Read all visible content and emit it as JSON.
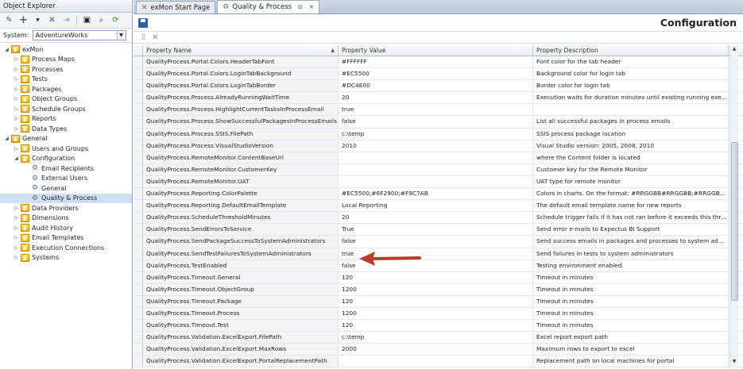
{
  "explorer": {
    "title": "Object Explorer",
    "system_label": "System:",
    "system_value": "AdventureWorks",
    "tree": [
      {
        "label": "exMon",
        "level": 0,
        "expanded": true,
        "icon": "folder-icon",
        "id": "exmon"
      },
      {
        "label": "Process Maps",
        "level": 1,
        "expanded": false,
        "icon": "folder-icon",
        "id": "process-maps"
      },
      {
        "label": "Processes",
        "level": 1,
        "expanded": false,
        "icon": "folder-icon",
        "id": "processes"
      },
      {
        "label": "Tests",
        "level": 1,
        "expanded": false,
        "icon": "folder-icon",
        "id": "tests"
      },
      {
        "label": "Packages",
        "level": 1,
        "expanded": false,
        "icon": "folder-icon",
        "id": "packages"
      },
      {
        "label": "Object Groups",
        "level": 1,
        "expanded": false,
        "icon": "folder-icon",
        "id": "object-groups"
      },
      {
        "label": "Schedule Groups",
        "level": 1,
        "expanded": false,
        "icon": "folder-icon",
        "id": "schedule-groups"
      },
      {
        "label": "Reports",
        "level": 1,
        "expanded": false,
        "icon": "folder-icon",
        "id": "reports"
      },
      {
        "label": "Data Types",
        "level": 1,
        "expanded": false,
        "icon": "folder-icon",
        "id": "data-types"
      },
      {
        "label": "General",
        "level": 0,
        "expanded": true,
        "icon": "folder-icon",
        "id": "general"
      },
      {
        "label": "Users and Groups",
        "level": 1,
        "expanded": false,
        "icon": "folder-icon",
        "id": "users-and-groups"
      },
      {
        "label": "Configuration",
        "level": 1,
        "expanded": true,
        "icon": "folder-icon",
        "id": "configuration"
      },
      {
        "label": "Email Recipients",
        "level": 2,
        "leaf": true,
        "icon": "gear-icon",
        "id": "email-recipients"
      },
      {
        "label": "External Users",
        "level": 2,
        "leaf": true,
        "icon": "gear-icon",
        "id": "external-users"
      },
      {
        "label": "General",
        "level": 2,
        "leaf": true,
        "icon": "gear-icon",
        "id": "config-general"
      },
      {
        "label": "Quality & Process",
        "level": 2,
        "leaf": true,
        "icon": "gear-icon",
        "id": "quality-process",
        "selected": true
      },
      {
        "label": "Data Providers",
        "level": 1,
        "expanded": false,
        "icon": "folder-icon",
        "id": "data-providers"
      },
      {
        "label": "Dimensions",
        "level": 1,
        "expanded": false,
        "icon": "folder-icon",
        "id": "dimensions"
      },
      {
        "label": "Audit History",
        "level": 1,
        "expanded": false,
        "icon": "folder-icon",
        "id": "audit-history"
      },
      {
        "label": "Email Templates",
        "level": 1,
        "expanded": false,
        "icon": "folder-icon",
        "id": "email-templates"
      },
      {
        "label": "Execution Connections",
        "level": 1,
        "expanded": false,
        "icon": "folder-icon",
        "id": "execution-connections"
      },
      {
        "label": "Systems",
        "level": 1,
        "expanded": false,
        "icon": "folder-icon",
        "id": "systems"
      }
    ]
  },
  "tabs": [
    {
      "label": "exMon Start Page",
      "active": false,
      "icon": "start-page-icon"
    },
    {
      "label": "Quality & Process",
      "active": true,
      "icon": "settings-icon"
    }
  ],
  "header": {
    "title": "Configuration"
  },
  "grid": {
    "columns": [
      "Property Name",
      "Property Value",
      "Property Description"
    ],
    "rows": [
      [
        "QualityProcess.Portal.Colors.HeaderTabFont",
        "#FFFFFF",
        "Font color for the tab header"
      ],
      [
        "QualityProcess.Portal.Colors.LoginTabBackground",
        "#EC5500",
        "Background color for login tab"
      ],
      [
        "QualityProcess.Portal.Colors.LoginTabBorder",
        "#DC4E00",
        "Border color for login tab"
      ],
      [
        "QualityProcess.Process.AlreadyRunningWaitTime",
        "20",
        "Execution waits for duration minutes until existing running execution f..."
      ],
      [
        "QualityProcess.Process.HighlightCurrentTasksInProcessEmail",
        "true",
        ""
      ],
      [
        "QualityProcess.Process.ShowSuccessfulPackagesInProcessEmails",
        "false",
        "List all successful packages in process emails"
      ],
      [
        "QualityProcess.Process.SSIS.FilePath",
        "c:\\temp",
        "SSIS process package location"
      ],
      [
        "QualityProcess.Process.VisualStudioVersion",
        "2010",
        "Visual Studio version: 2005, 2008, 2010"
      ],
      [
        "QualityProcess.RemoteMonitor.ContentBaseUrl",
        "",
        "where the Content folder is located"
      ],
      [
        "QualityProcess.RemoteMonitor.CustomerKey",
        "",
        "Customer key for the Remote Monitor"
      ],
      [
        "QualityProcess.RemoteMonitor.UAT",
        "",
        "UAT type for remote monitor"
      ],
      [
        "QualityProcess.Reporting.ColorPalette",
        "#EC5500;#6F2900;#F9C7AB",
        "Colors in charts. On the format: #RRGGBB#RRGGBB;#RRGGBB#RRG..."
      ],
      [
        "QualityProcess.Reporting.DefaultEmailTemplate",
        "Local Reporting",
        "The default email template name for new reports"
      ],
      [
        "QualityProcess.ScheduleThresholdMinutes",
        "20",
        "Schedule trigger fails if it has not ran before it exceeds this threshold"
      ],
      [
        "QualityProcess.SendErrorsToService",
        "True",
        "Send error e-mails to Expectus BI Support"
      ],
      [
        "QualityProcess.SendPackageSuccessToSystemAdministrators",
        "false",
        "Send success emails in packages and processes to system administrator"
      ],
      [
        "QualityProcess.SendTestFailuresToSystemAdministrators",
        "true",
        "Send failures in tests to system administrators"
      ],
      [
        "QualityProcess.TestEnabled",
        "false",
        "Testing environment enabled."
      ],
      [
        "QualityProcess.Timeout.General",
        "120",
        "Timeout in minutes"
      ],
      [
        "QualityProcess.Timeout.ObjectGroup",
        "1200",
        "Timeout in minutes"
      ],
      [
        "QualityProcess.Timeout.Package",
        "120",
        "Timeout in minutes"
      ],
      [
        "QualityProcess.Timeout.Process",
        "1200",
        "Timeout in minutes"
      ],
      [
        "QualityProcess.Timeout.Test",
        "120",
        "Timeout in minutes"
      ],
      [
        "QualityProcess.Validation.ExcelExport.FilePath",
        "c:\\temp",
        "Excel report export path"
      ],
      [
        "QualityProcess.Validation.ExcelExport.MaxRows",
        "2000",
        "Maximum rows to export to excel"
      ],
      [
        "QualityProcess.Validation.ExcelExport.PortalReplacementPath",
        "",
        "Replacement path on local machines for portal"
      ]
    ]
  },
  "colors": {
    "arrow": "#c0392b",
    "selection": "#cfe0f5",
    "save_icon": "#2f5fa8"
  }
}
